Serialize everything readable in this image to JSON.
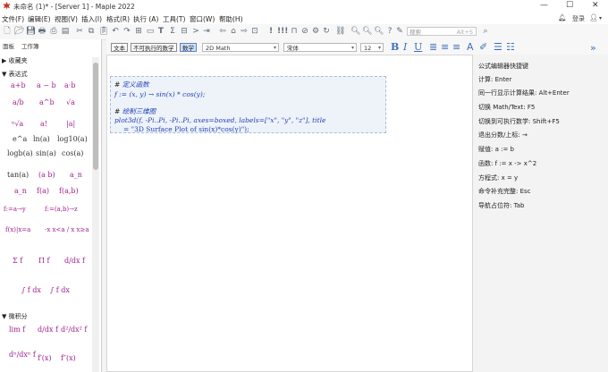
{
  "window": {
    "title": "未命名 (1)* - [Server 1] - Maple 2022",
    "user_label": "登录"
  },
  "menu": {
    "items": [
      "文件(F)",
      "编辑(E)",
      "视图(V)",
      "插入(I)",
      "格式(R)",
      "执行 (A)",
      "工具(T)",
      "窗口(W)",
      "帮助(H)"
    ]
  },
  "toolbar": {
    "search_placeholder": "搜索",
    "search_shortcut": "Alt+S",
    "icons": [
      "new-document-icon",
      "open-icon",
      "save-icon",
      "print-icon",
      "print-preview-icon",
      "layout-icon",
      "cut-icon",
      "copy-icon",
      "paste-icon",
      "text-icon",
      "math-text-icon",
      "table-icon",
      "prompt-icon",
      "back-icon",
      "home-icon",
      "forward-icon",
      "execute-icon",
      "execute-all-icon",
      "debug-icon",
      "stop-icon",
      "restart-icon",
      "link-icon",
      "zoom-100-icon",
      "zoom-150-icon",
      "zoom-200-icon",
      "help-icon",
      "pencil-icon"
    ]
  },
  "palette": {
    "tabs": [
      "面板",
      "工作簿"
    ],
    "sections": {
      "favorites": "▶ 收藏夹",
      "expression": "▼ 表达式",
      "calculus": "▼ 微积分"
    },
    "expression_rows": [
      [
        "a+b",
        "a − b",
        "a·b"
      ],
      [
        "a/b",
        "a^b",
        "√a"
      ],
      [
        "ⁿ√a",
        "a!",
        "|a|"
      ],
      [
        "e^a",
        "ln(a)",
        "log10(a)"
      ],
      [
        "logb(a)",
        "sin(a)",
        "cos(a)"
      ],
      [
        "tan(a)",
        "(a b)",
        "a_n"
      ],
      [
        "a_n",
        "f(a)",
        "f(a,b)"
      ],
      [
        "f:=a→y",
        "f:=(a,b)→z"
      ],
      [
        "f(x)|x=a",
        "-x  x<a / x  x≥a"
      ],
      [
        "Σ f",
        "Π f",
        "d/dx f"
      ],
      [
        "∫ f dx",
        "∫ f dx"
      ]
    ],
    "calculus_rows": [
      [
        "lim f",
        "d/dx f",
        "d²/dx² f"
      ],
      [
        "dⁿ/dxⁿ f",
        "f′(x)",
        "f″(x)"
      ]
    ]
  },
  "formatbar": {
    "text_button": "文本",
    "nonexec_button": "不可执行的数学",
    "math_button": "数学",
    "style_combo": "2D Math",
    "font_combo": "宋体",
    "size_combo": "12",
    "bold": "B",
    "italic": "I",
    "underline": "U"
  },
  "document": {
    "comment1": "定义函数",
    "line1": "f := (x, y) → sin(x) * cos(y);",
    "comment2": "绘制三维图",
    "line2": "plot3d(f, -Pi..Pi, -Pi..Pi, axes=boxed, labels=[\"x\", \"y\", \"z\"], title",
    "line3": "= \"3D Surface Plot of sin(x)*cos(y)\");"
  },
  "shortcuts": {
    "heading": "公式编辑器快捷键",
    "items": [
      "计算: Enter",
      "同一行显示计算结果: Alt+Enter",
      "切换 Math/Text: F5",
      "切换到可执行数学: Shift+F5",
      "退出分数/上标: →",
      "赋值: a := b",
      "函数: f := x -> x^2",
      "方程式: x = y",
      "命令补充完整: Esc",
      "导航占位符: Tab"
    ]
  },
  "colors": {
    "accent": "#3d6fb6",
    "palette_symbol": "#a0208f",
    "code": "#1f3fb5"
  }
}
